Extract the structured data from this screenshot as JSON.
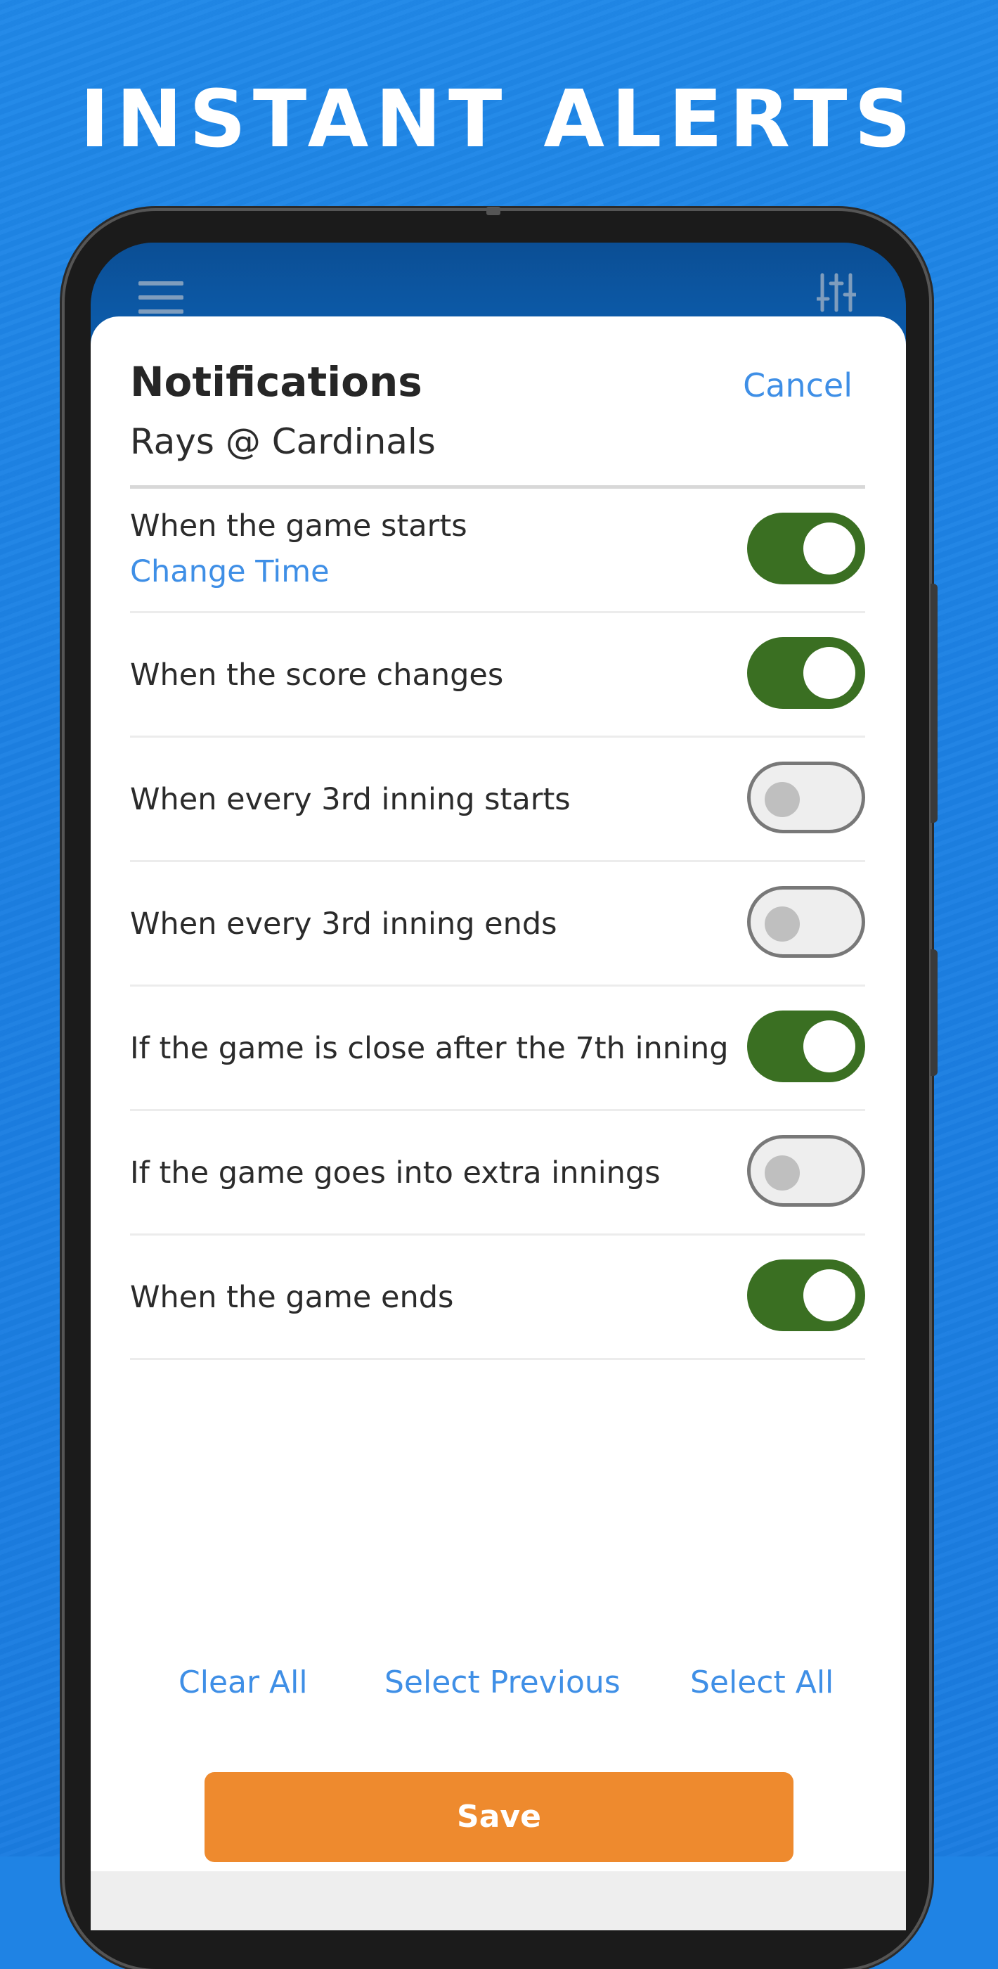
{
  "headline": "INSTANT ALERTS",
  "app_bar": {
    "menu_icon": "hamburger-menu",
    "filter_icon": "sliders-filter"
  },
  "sheet": {
    "title": "Notifications",
    "cancel_label": "Cancel",
    "subtitle": "Rays @ Cardinals"
  },
  "rows": [
    {
      "label": "When the game starts",
      "sub": "Change Time",
      "on": true
    },
    {
      "label": "When the score changes",
      "on": true
    },
    {
      "label": "When every 3rd inning starts",
      "on": false
    },
    {
      "label": "When every 3rd inning ends",
      "on": false
    },
    {
      "label": "If the game is close after the 7th inning",
      "on": true
    },
    {
      "label": "If the game goes into extra innings",
      "on": false
    },
    {
      "label": "When the game ends",
      "on": true
    }
  ],
  "actions": {
    "clear_all": "Clear All",
    "select_previous": "Select Previous",
    "select_all": "Select All"
  },
  "save_label": "Save",
  "colors": {
    "background": "#1f83e4",
    "toggle_on": "#3a6f22",
    "link": "#3f8fe6",
    "save": "#ee8a2e"
  }
}
